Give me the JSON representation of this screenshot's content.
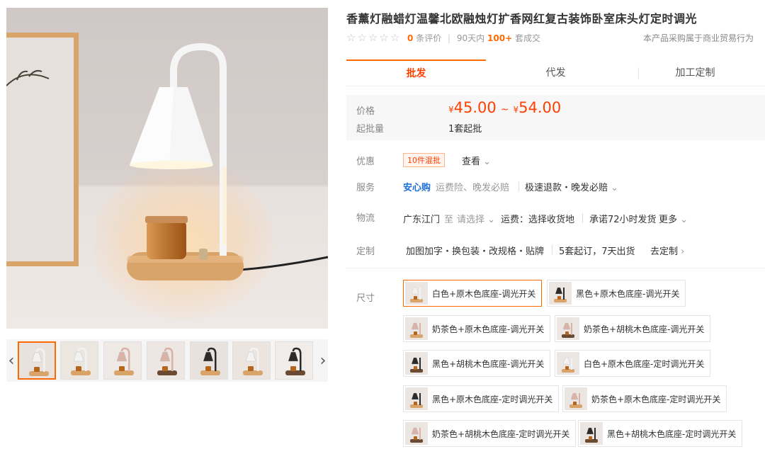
{
  "product": {
    "title": "香薰灯融蜡灯温馨北欧融烛灯扩香网红复古装饰卧室床头灯定时调光",
    "reviews_count": "0",
    "reviews_suffix": "条评价",
    "sales_prefix": "90天内",
    "sales_count": "100+",
    "sales_suffix": "套成交",
    "trade_note": "本产品采购属于商业贸易行为"
  },
  "tabs": [
    {
      "label": "批发"
    },
    {
      "label": "代发"
    },
    {
      "label": "加工定制"
    }
  ],
  "pricing": {
    "price_label": "价格",
    "currency": "¥",
    "price_min": "45.00",
    "tilde": "~",
    "price_max": "54.00",
    "min_order_label": "起批量",
    "min_order_value": "1套起批"
  },
  "promo": {
    "label": "优惠",
    "tag": "10件混批",
    "view": "查看"
  },
  "service": {
    "label": "服务",
    "safe": "安心购",
    "desc": "运费险、晚发必赔",
    "extra": "极速退款・晚发必赔"
  },
  "logistics": {
    "label": "物流",
    "origin": "广东江门",
    "to": "至",
    "select": "请选择",
    "freight": "运费：选择收货地",
    "promise": "承诺72小时发货",
    "more": "更多"
  },
  "custom": {
    "label": "定制",
    "options": "加图加字・换包装・改规格・贴牌",
    "terms": "5套起订，7天出货",
    "go": "去定制"
  },
  "size": {
    "label": "尺寸",
    "options": [
      {
        "label": "白色+原木色底座-调光开关",
        "lamp": "#f2f2f2"
      },
      {
        "label": "黑色+原木色底座-调光开关",
        "lamp": "#2b2b2b"
      },
      {
        "label": "奶茶色+原木色底座-调光开关",
        "lamp": "#d9b3a8"
      },
      {
        "label": "奶茶色+胡桃木色底座-调光开关",
        "lamp": "#d9b3a8"
      },
      {
        "label": "黑色+胡桃木色底座-调光开关",
        "lamp": "#2b2b2b"
      },
      {
        "label": "白色+原木色底座-定时调光开关",
        "lamp": "#f2f2f2"
      },
      {
        "label": "黑色+原木色底座-定时调光开关",
        "lamp": "#2b2b2b"
      },
      {
        "label": "奶茶色+原木色底座-定时调光开关",
        "lamp": "#d9b3a8"
      },
      {
        "label": "奶茶色+胡桃木色底座-定时调光开关",
        "lamp": "#d9b3a8"
      },
      {
        "label": "黑色+胡桃木色底座-定时调光开关",
        "lamp": "#2b2b2b"
      }
    ]
  },
  "gallery": {
    "thumbnails": [
      {
        "lamp": "#f2f2f2",
        "base": "#d9a46a",
        "bg": "#e9e1dd"
      },
      {
        "lamp": "#f2f2f2",
        "base": "#d9a46a",
        "bg": "#ece6e1"
      },
      {
        "lamp": "#d9b3a8",
        "base": "#d9a46a",
        "bg": "#efe9e6"
      },
      {
        "lamp": "#d9b3a8",
        "base": "#6b4a33",
        "bg": "#ede6e2"
      },
      {
        "lamp": "#2b2b2b",
        "base": "#d9a46a",
        "bg": "#e8e2de"
      },
      {
        "lamp": "#f2f2f2",
        "base": "#d9a46a",
        "bg": "#ece4df"
      },
      {
        "lamp": "#2b2b2b",
        "base": "#6b4a33",
        "bg": "#f0ecea"
      }
    ]
  },
  "colors": {
    "accent": "#ff6a00",
    "price": "#ff4000",
    "safe_blue": "#1e6fd9"
  }
}
